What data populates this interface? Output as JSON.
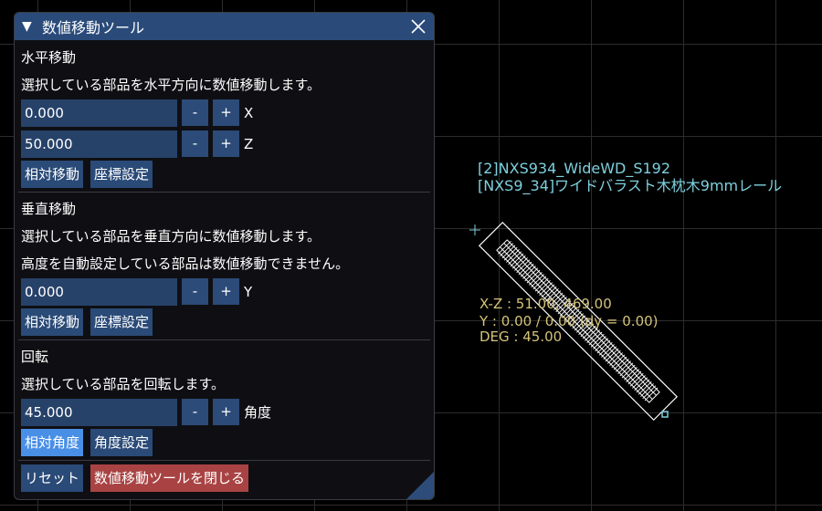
{
  "window": {
    "title": "数値移動ツール",
    "collapse_glyph": "▼",
    "close_icon": "close-icon"
  },
  "horizontal": {
    "heading": "水平移動",
    "description": "選択している部品を水平方向に数値移動します。",
    "x_value": "0.000",
    "z_value": "50.000",
    "x_label": "X",
    "z_label": "Z",
    "minus": "-",
    "plus": "+",
    "relative_button": "相対移動",
    "absolute_button": "座標設定"
  },
  "vertical": {
    "heading": "垂直移動",
    "description": "選択している部品を垂直方向に数値移動します。",
    "note": "高度を自動設定している部品は数値移動できません。",
    "y_value": "0.000",
    "y_label": "Y",
    "minus": "-",
    "plus": "+",
    "relative_button": "相対移動",
    "absolute_button": "座標設定"
  },
  "rotation": {
    "heading": "回転",
    "description": "選択している部品を回転します。",
    "angle_value": "45.000",
    "angle_label": "角度",
    "minus": "-",
    "plus": "+",
    "relative_button": "相対角度",
    "absolute_button": "角度設定"
  },
  "footer": {
    "reset_button": "リセット",
    "close_tool_button": "数値移動ツールを閉じる"
  },
  "viewport": {
    "part_id": "[2]NXS934_WideWD_S192",
    "part_name": "[NXS9_34]ワイドバラスト木枕木9mmレール",
    "coord_xz": "X-Z :  51.00,  469.00",
    "coord_y": "Y :       0.00 / 0.00 (dy =    0.00)",
    "coord_deg": "DEG : 45.00"
  },
  "colors": {
    "title_bar": "#2a4b7a",
    "button": "#2a4a77",
    "active_button": "#4a8fe6",
    "danger_button": "#a94343",
    "part_label": "#7ed0de",
    "coord_label": "#d4c37a"
  }
}
